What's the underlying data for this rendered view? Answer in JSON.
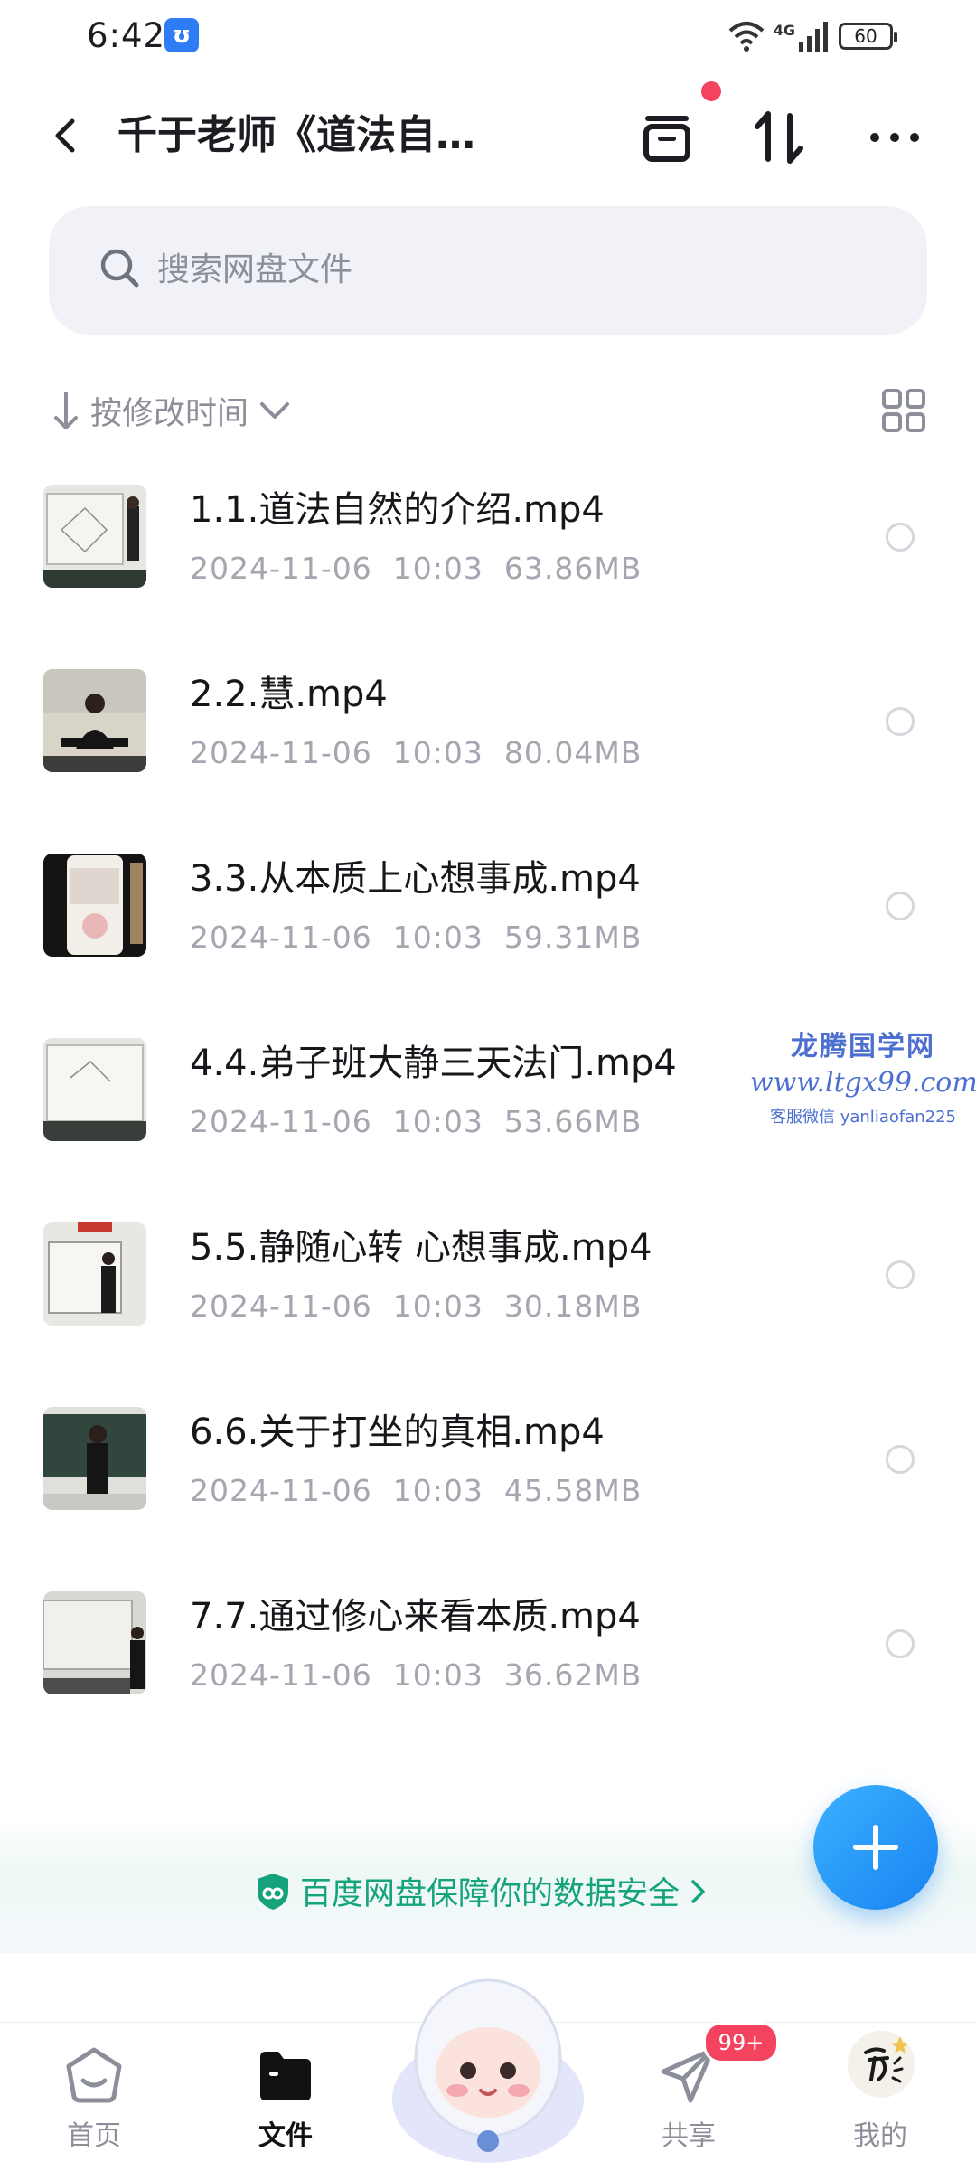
{
  "status_bar": {
    "time": "6:42",
    "network": "4G",
    "battery": "60",
    "app_icon": "notification-app-icon"
  },
  "header": {
    "title": "千于老师《道法自…"
  },
  "search": {
    "placeholder": "搜索网盘文件"
  },
  "sort": {
    "label": "按修改时间"
  },
  "files": [
    {
      "name": "1.1.道法自然的介绍.mp4",
      "date": "2024-11-06",
      "time": "10:03",
      "size": "63.86MB"
    },
    {
      "name": "2.2.慧.mp4",
      "date": "2024-11-06",
      "time": "10:03",
      "size": "80.04MB"
    },
    {
      "name": "3.3.从本质上心想事成.mp4",
      "date": "2024-11-06",
      "time": "10:03",
      "size": "59.31MB"
    },
    {
      "name": "4.4.弟子班大静三天法门.mp4",
      "date": "2024-11-06",
      "time": "10:03",
      "size": "53.66MB"
    },
    {
      "name": "5.5.静随心转 心想事成.mp4",
      "date": "2024-11-06",
      "time": "10:03",
      "size": "30.18MB"
    },
    {
      "name": "6.6.关于打坐的真相.mp4",
      "date": "2024-11-06",
      "time": "10:03",
      "size": "45.58MB"
    },
    {
      "name": "7.7.通过修心来看本质.mp4",
      "date": "2024-11-06",
      "time": "10:03",
      "size": "36.62MB"
    }
  ],
  "watermark": {
    "title": "龙腾国学网",
    "url": "www.ltgx99.com",
    "contact": "客服微信 yanliaofan225"
  },
  "security_banner": {
    "text": "百度网盘保障你的数据安全"
  },
  "bottom_nav": {
    "items": [
      {
        "label": "首页",
        "active": false
      },
      {
        "label": "文件",
        "active": true
      },
      {
        "label": "共享",
        "active": false
      },
      {
        "label": "我的",
        "active": false
      }
    ],
    "share_badge": "99+"
  },
  "colors": {
    "accent": "#1883f2",
    "security_green": "#15a37b",
    "badge_red": "#f4435e"
  }
}
